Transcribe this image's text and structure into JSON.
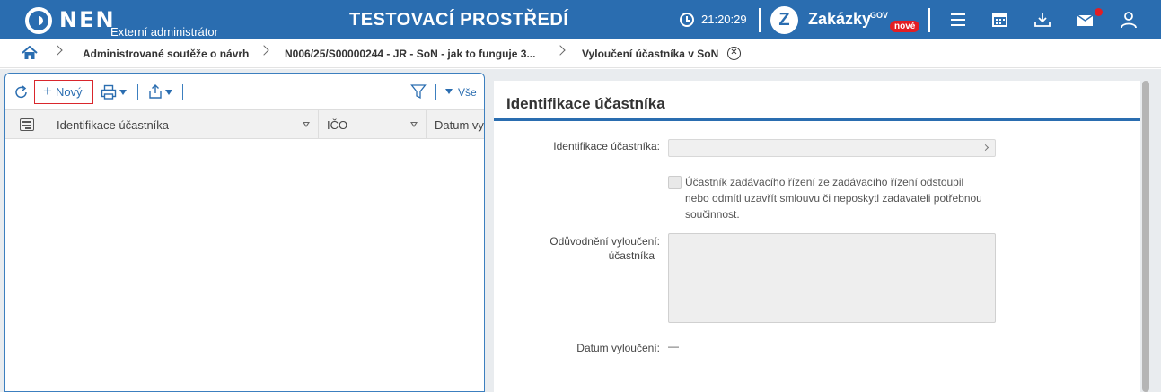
{
  "header": {
    "brand": "NEN",
    "role": "Externí administrátor",
    "environment": "TESTOVACÍ PROSTŘEDÍ",
    "time": "21:20:29",
    "zakazky_letter": "Z",
    "zakazky_label": "Zakázky",
    "zakazky_sup": "GOV",
    "zakazky_badge": "nové",
    "icons": [
      "menu-icon",
      "calendar-icon",
      "download-icon",
      "mail-icon",
      "user-icon"
    ],
    "accent": "#2a6db0",
    "notification_color": "#e31e24"
  },
  "breadcrumb": {
    "items": [
      "Administrované soutěže o návrh",
      "N006/25/S00000244 - JR - SoN - jak to funguje 3...",
      "Vyloučení účastníka v SoN"
    ]
  },
  "toolbar": {
    "new_label": "Nový",
    "filter_label": "Vše"
  },
  "grid": {
    "columns": [
      "Identifikace účastníka",
      "IČO",
      "Datum vyl"
    ]
  },
  "form": {
    "section_title": "Identifikace účastníka",
    "field_identification_label": "Identifikace účastníka:",
    "checkbox_text": "Účastník zadávacího řízení ze zadávacího řízení odstoupil nebo odmítl uzavřít smlouvu či neposkytl zadavateli potřebnou součinnost.",
    "justification_label_line1": "Odůvodnění vyloučení:",
    "justification_label_line2": "účastníka",
    "date_label": "Datum vyloučení:",
    "date_value": "—"
  }
}
